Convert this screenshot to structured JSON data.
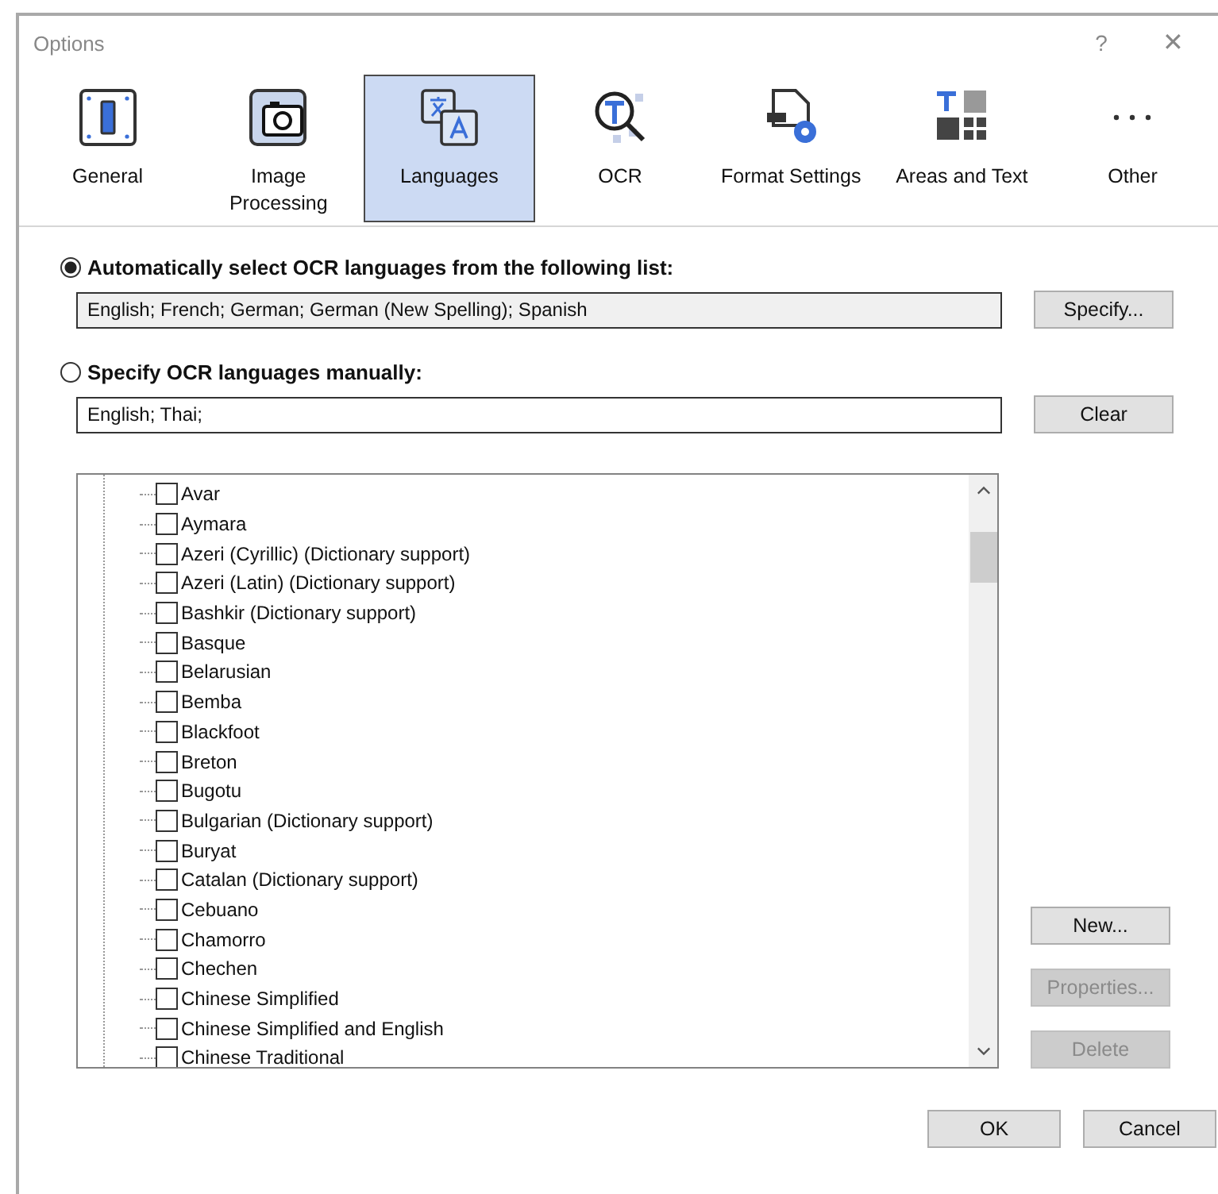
{
  "window": {
    "title": "Options",
    "help": "?",
    "close": "✕"
  },
  "tabs": [
    {
      "label": "General",
      "selected": false
    },
    {
      "label": "Image Processing",
      "selected": false
    },
    {
      "label": "Languages",
      "selected": true
    },
    {
      "label": "OCR",
      "selected": false
    },
    {
      "label": "Format Settings",
      "selected": false
    },
    {
      "label": "Areas and Text",
      "selected": false
    },
    {
      "label": "Other",
      "selected": false
    }
  ],
  "modes": [
    {
      "label": "Automatically select OCR languages from the following list:",
      "selected": true,
      "field": {
        "value": "English; French; German; German (New Spelling); Spanish",
        "disabled": true
      },
      "button": {
        "label": "Specify...",
        "disabled": false
      }
    },
    {
      "label": "Specify OCR languages manually:",
      "selected": false,
      "field": {
        "value": "English; Thai;",
        "disabled": false
      },
      "button": {
        "label": "Clear",
        "disabled": false
      }
    }
  ],
  "languages": [
    {
      "label": "Avar",
      "checked": false
    },
    {
      "label": "Aymara",
      "checked": false
    },
    {
      "label": "Azeri (Cyrillic) (Dictionary support)",
      "checked": false
    },
    {
      "label": "Azeri (Latin) (Dictionary support)",
      "checked": false
    },
    {
      "label": "Bashkir (Dictionary support)",
      "checked": false
    },
    {
      "label": "Basque",
      "checked": false
    },
    {
      "label": "Belarusian",
      "checked": false
    },
    {
      "label": "Bemba",
      "checked": false
    },
    {
      "label": "Blackfoot",
      "checked": false
    },
    {
      "label": "Breton",
      "checked": false
    },
    {
      "label": "Bugotu",
      "checked": false
    },
    {
      "label": "Bulgarian (Dictionary support)",
      "checked": false
    },
    {
      "label": "Buryat",
      "checked": false
    },
    {
      "label": "Catalan (Dictionary support)",
      "checked": false
    },
    {
      "label": "Cebuano",
      "checked": false
    },
    {
      "label": "Chamorro",
      "checked": false
    },
    {
      "label": "Chechen",
      "checked": false
    },
    {
      "label": "Chinese Simplified",
      "checked": false
    },
    {
      "label": "Chinese Simplified and English",
      "checked": false
    },
    {
      "label": "Chinese Traditional",
      "checked": false
    }
  ],
  "side_buttons": [
    {
      "label": "New...",
      "disabled": false
    },
    {
      "label": "Properties...",
      "disabled": true
    },
    {
      "label": "Delete",
      "disabled": true
    }
  ],
  "footer_buttons": [
    {
      "label": "OK"
    },
    {
      "label": "Cancel"
    }
  ]
}
